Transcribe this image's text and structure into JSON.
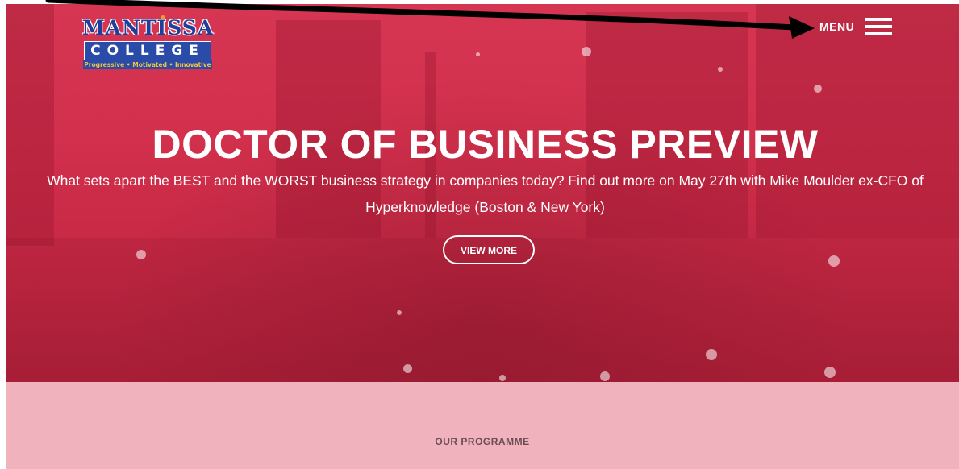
{
  "header": {
    "logo": {
      "name_top": "MANTISSA",
      "name_bottom": "COLLEGE",
      "tagline": "Progressive • Motivated • Innovative"
    },
    "menu_label": "MENU",
    "menu_icon": "hamburger-icon"
  },
  "hero": {
    "title": "DOCTOR OF BUSINESS PREVIEW",
    "subtitle": "What sets apart the BEST and the WORST business strategy in companies today? Find out more on May 27th with Mike Moulder ex-CFO of Hyperknowledge (Boston & New York)",
    "cta_label": "VIEW MORE"
  },
  "programme": {
    "heading": "OUR PROGRAMME"
  },
  "colors": {
    "hero_overlay": "#d2304c",
    "programme_bg": "#f0b2bc",
    "logo_blue": "#2a4ba8",
    "logo_gold": "#f4c33a"
  }
}
